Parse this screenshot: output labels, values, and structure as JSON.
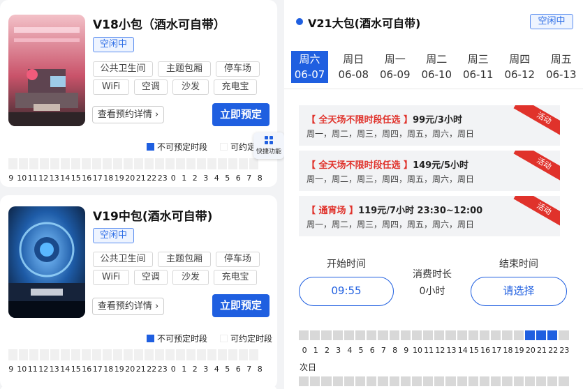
{
  "rooms": [
    {
      "name": "V18小包（酒水可自带）",
      "status": "空闲中",
      "tags": [
        "公共卫生间",
        "主题包厢",
        "停车场",
        "WiFi",
        "空调",
        "沙发",
        "充电宝"
      ],
      "detail_label": "查看预约详情 ›",
      "book_label": "立即预定",
      "legend_unavailable": "不可预定时段",
      "legend_available": "可约定"
    },
    {
      "name": "V19中包(酒水可自带)",
      "status": "空闲中",
      "tags": [
        "公共卫生间",
        "主题包厢",
        "停车场",
        "WiFi",
        "空调",
        "沙发",
        "充电宝"
      ],
      "detail_label": "查看预约详情 ›",
      "book_label": "立即预定",
      "legend_unavailable": "不可预定时段",
      "legend_available": "可约定时段"
    }
  ],
  "left_hours": [
    "9",
    "10",
    "11",
    "12",
    "13",
    "14",
    "15",
    "16",
    "17",
    "18",
    "19",
    "20",
    "21",
    "22",
    "23",
    "0",
    "1",
    "2",
    "3",
    "4",
    "5",
    "6",
    "7",
    "8"
  ],
  "quick_function_label": "快捷功能",
  "detail": {
    "room_name": "V21大包(酒水可自带)",
    "status": "空闲中",
    "days": [
      {
        "weekday": "周六",
        "date": "06-07",
        "selected": true
      },
      {
        "weekday": "周日",
        "date": "06-08"
      },
      {
        "weekday": "周一",
        "date": "06-09"
      },
      {
        "weekday": "周二",
        "date": "06-10"
      },
      {
        "weekday": "周三",
        "date": "06-11"
      },
      {
        "weekday": "周四",
        "date": "06-12"
      },
      {
        "weekday": "周五",
        "date": "06-13"
      }
    ],
    "promotions": [
      {
        "tag": "【 全天场不限时段任选 】",
        "price": "99元/3小时",
        "days": "周一，周二，周三，周四，周五，周六，周日",
        "badge": "活动"
      },
      {
        "tag": "【 全天场不限时段任选 】",
        "price": "149元/5小时",
        "days": "周一，周二，周三，周四，周五，周六，周日",
        "badge": "活动"
      },
      {
        "tag": "【 通宵场 】",
        "price": "119元/7小时  23:30~12:00",
        "days": "周一，周二，周三，周四，周五，周六，周日",
        "badge": "活动"
      }
    ],
    "start_label": "开始时间",
    "start_value": "09:55",
    "duration_label": "消费时长",
    "duration_value": "0小时",
    "end_label": "结束时间",
    "end_value": "请选择",
    "hours": [
      "0",
      "1",
      "2",
      "3",
      "4",
      "5",
      "6",
      "7",
      "8",
      "9",
      "10",
      "11",
      "12",
      "13",
      "14",
      "15",
      "16",
      "17",
      "18",
      "19",
      "20",
      "21",
      "22",
      "23"
    ],
    "unavailable_hours": [
      "20",
      "21",
      "22"
    ],
    "next_day_label": "次日"
  },
  "colors": {
    "primary": "#1f5fe0",
    "promo_red": "#e0322b",
    "bg": "#f2f3f5"
  }
}
